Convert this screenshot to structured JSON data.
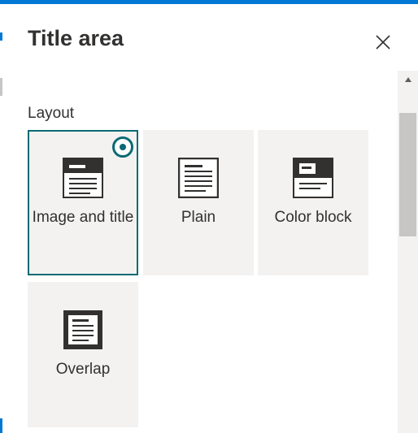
{
  "panel": {
    "title": "Title area"
  },
  "layout": {
    "section_label": "Layout",
    "selected": "image-and-title",
    "options": [
      {
        "id": "image-and-title",
        "label": "Image and title",
        "icon": "image-and-title-layout-icon",
        "selected": true
      },
      {
        "id": "plain",
        "label": "Plain",
        "icon": "plain-layout-icon",
        "selected": false
      },
      {
        "id": "color-block",
        "label": "Color block",
        "icon": "color-block-layout-icon",
        "selected": false
      },
      {
        "id": "overlap",
        "label": "Overlap",
        "icon": "overlap-layout-icon",
        "selected": false
      }
    ]
  },
  "colors": {
    "accent": "#0b6a74",
    "top_bar": "#0078d4",
    "tile_bg": "#f3f2f1",
    "icon_dark": "#323130"
  }
}
